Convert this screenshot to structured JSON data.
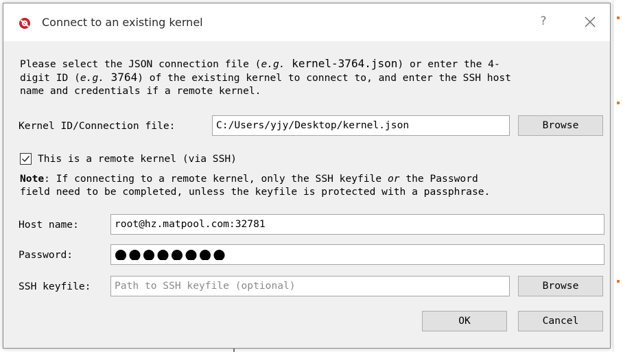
{
  "dialog": {
    "title": "Connect to an existing kernel",
    "help_label": "?",
    "description": {
      "line1_a": "Please select the JSON connection file (",
      "line1_eg": "e.g.",
      "line1_file": " kernel-3764.json",
      "line1_b": ") or enter the 4-",
      "line2_a": "digit ID (",
      "line2_eg": "e.g.",
      "line2_id": " 3764",
      "line2_b": ") of the existing kernel to connect to, and enter the SSH host",
      "line3": "name and credentials if a remote kernel."
    },
    "kernel_label": "Kernel ID/Connection file:",
    "kernel_value": "C:/Users/yjy/Desktop/kernel.json",
    "browse_label": "Browse",
    "remote_checkbox_label": "This is a remote kernel (via SSH)",
    "remote_checked": true,
    "note": {
      "bold": "Note",
      "line1_a": ": If connecting to a remote kernel, only the SSH keyfile ",
      "line1_or": "or",
      "line1_b": " the Password",
      "line2": "field need to be completed, unless the keyfile is protected with a passphrase."
    },
    "host_label": "Host name:",
    "host_value": "root@hz.matpool.com:32781",
    "password_label": "Password:",
    "password_masked_count": 8,
    "keyfile_label": "SSH keyfile:",
    "keyfile_placeholder": "Path to SSH keyfile (optional)",
    "keyfile_browse_label": "Browse",
    "ok_label": "OK",
    "cancel_label": "Cancel"
  },
  "colors": {
    "dialog_bg": "#f0f0f0",
    "titlebar_bg": "#ffffff",
    "button_bg": "#e1e1e1",
    "icon_red": "#c0262d"
  },
  "icons": [
    "spyder-icon",
    "close-icon",
    "checkmark-icon"
  ]
}
